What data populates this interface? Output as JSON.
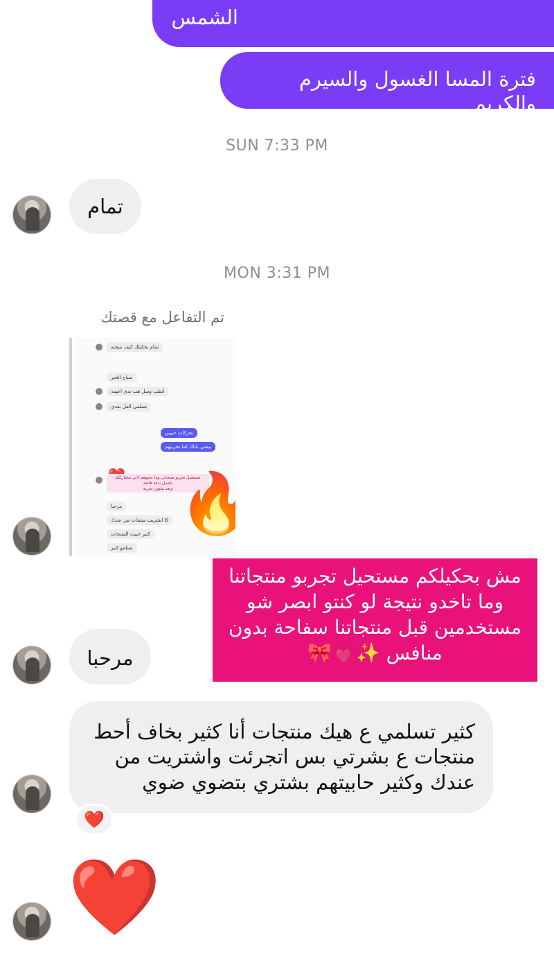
{
  "messages_out": [
    {
      "text": "الشمس"
    },
    {
      "text": "فترة المسا الغسول والسيرم والكريم"
    }
  ],
  "timestamps": [
    "SUN 7:33 PM",
    "MON 3:31 PM"
  ],
  "incoming": {
    "msg1": "تمام",
    "story_label": "تم التفاعل مع قصتك",
    "story_shot": {
      "rows": [
        "تمام بحكيلك كيف نتيجته",
        "صباح الخير",
        "انطب وسل هب بدي اعيمه",
        "تسلمي الفل بعدي",
        "تحركات حبيبي",
        "بيشي باباك لما تجربيهم",
        "مستحيل تجربو منتجاتي وما تحبوهم لاني مختارلكم باجمل بدقة فائقة",
        "وبعد مليون تجربة",
        "مرحبا",
        "كا اشتريت منتجات من عندك",
        "كثير حبيت المنتجات",
        "تسلمو كثير"
      ],
      "fire_emoji": "🔥",
      "heart_emoji": "❤️"
    },
    "pink_caption": "مش بحكيلكم مستحيل تجربو منتجاتنا وما تاخدو نتيجة لو كنتو ابصر شو مستخدمين قبل منتجاتنا سفاحة بدون منافس ✨💗🎀",
    "msg2": "مرحبا",
    "msg3": "كثير تسلمي ع هيك منتجات أنا كثير بخاف أحط منتجات ع بشرتي بس اتجرئت واشتريت من عندك وكثير حابيتهم بشتري بتضوي ضوي",
    "reaction": "❤️",
    "big_heart": "❤️"
  },
  "colors": {
    "outgoing_bubble": "#7b3cf5",
    "incoming_bubble": "#efefef",
    "caption_box": "#e8127a",
    "timestamp": "#8e8e8e"
  }
}
